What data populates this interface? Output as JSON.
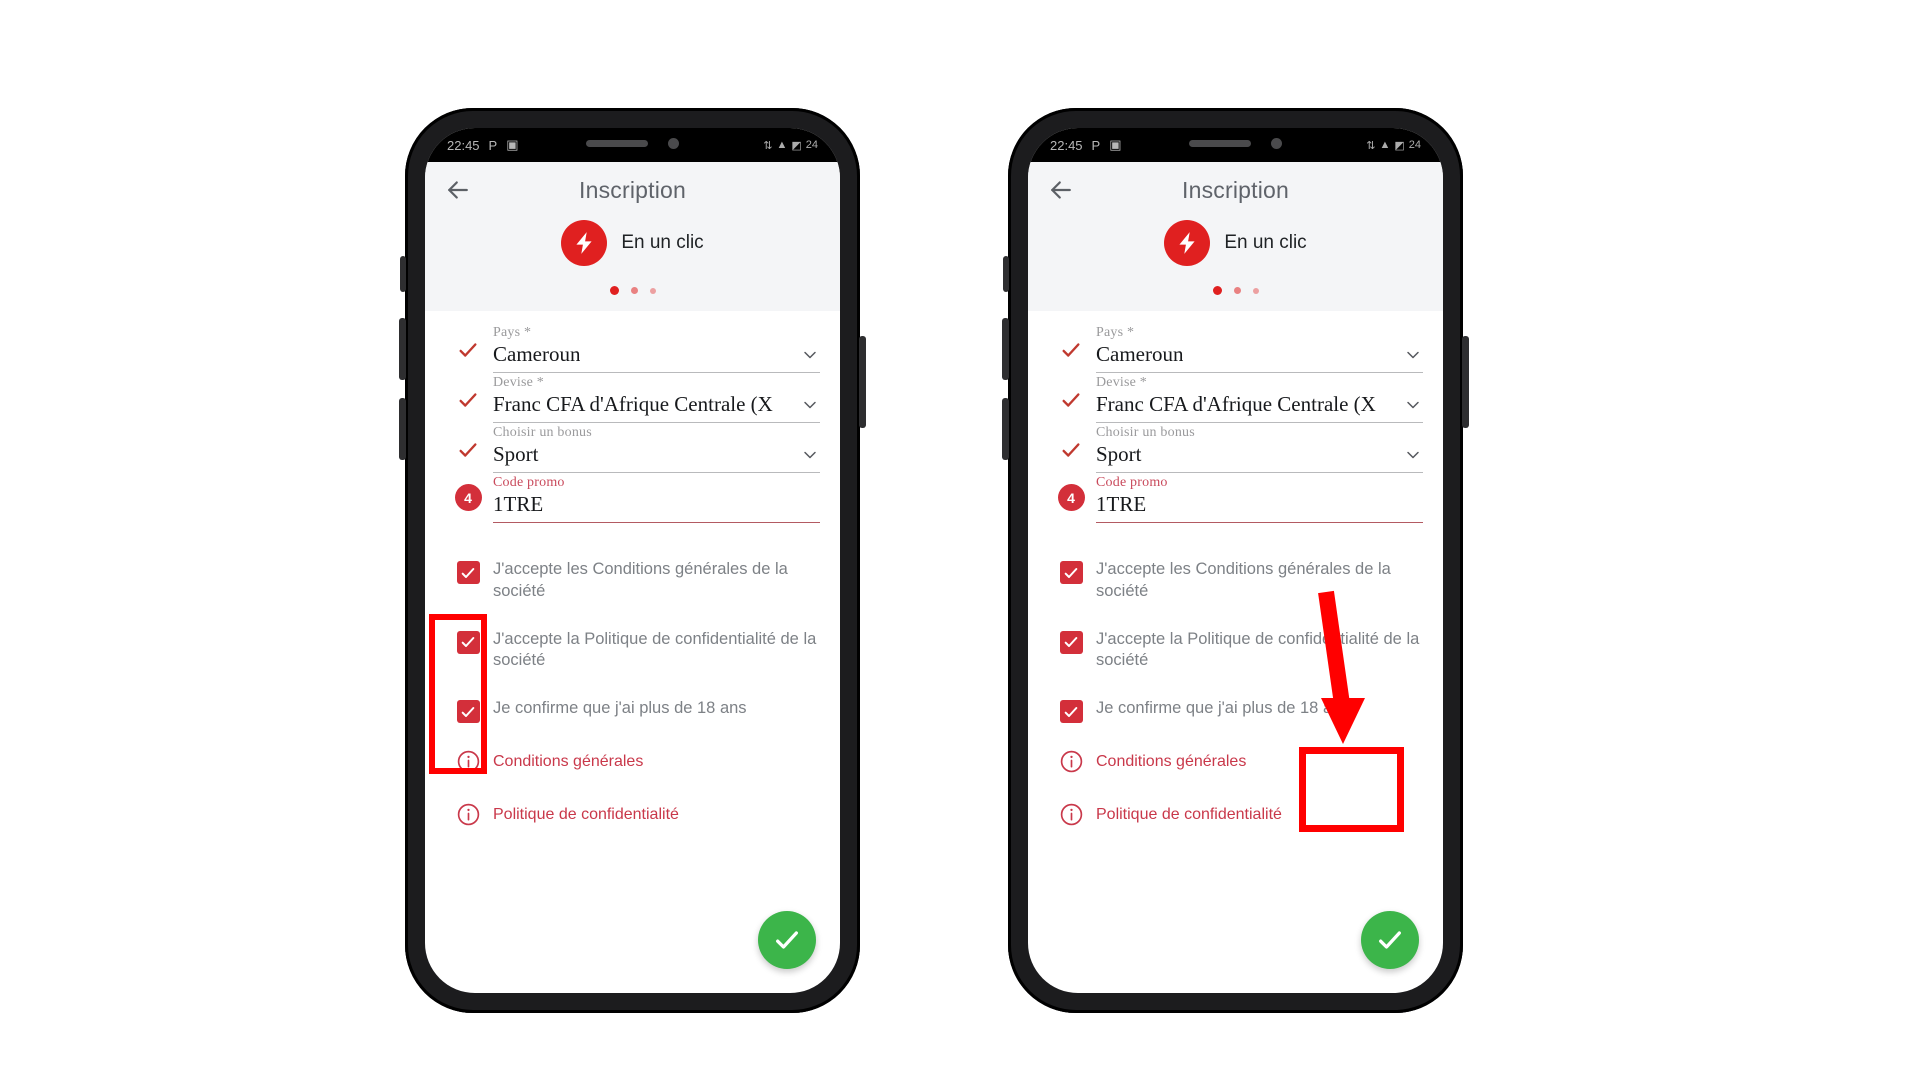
{
  "colors": {
    "brand_red": "#e02020",
    "accent_red": "#d32f3a",
    "link_red": "#c9384a",
    "promo_label": "#c94a5c",
    "check_red": "#d32f3a",
    "fab_green": "#3cb54a",
    "annotation_red": "#ff0000",
    "title_grey": "#5f636a",
    "label_grey": "#9a9a9c",
    "text_grey": "#7d8186",
    "value_dark": "#17191c",
    "screen_bg_top": "#f4f5f7"
  },
  "status_bar": {
    "time": "22:45",
    "left_icons": [
      "P",
      "message-icon"
    ],
    "right_icons": [
      "network-icon",
      "wifi-icon",
      "signal-icon"
    ],
    "battery": "24"
  },
  "header": {
    "back_icon": "arrow-left-icon",
    "title": "Inscription",
    "promo_icon": "bolt-icon",
    "promo_label": "En un clic",
    "dots": 3,
    "active_dot": 1
  },
  "form": {
    "fields": [
      {
        "label": "Pays *",
        "value": "Cameroun",
        "lead": "check",
        "control": "chevron-down-icon",
        "promo": false
      },
      {
        "label": "Devise *",
        "value": "Franc CFA d'Afrique Centrale (X",
        "lead": "check",
        "control": "chevron-down-icon",
        "promo": false
      },
      {
        "label": "Choisir un bonus",
        "value": "Sport",
        "lead": "check",
        "control": "chevron-down-icon",
        "promo": false
      },
      {
        "label": "Code promo",
        "value": "1TRE",
        "lead": "badge",
        "badge_text": "4",
        "control": "none",
        "promo": true
      }
    ]
  },
  "checkboxes": [
    {
      "checked": true,
      "label": "J'accepte les Conditions générales de la société"
    },
    {
      "checked": true,
      "label": "J'accepte la Politique de confidentialité de la société"
    },
    {
      "checked": true,
      "label": "Je confirme que j'ai plus de 18 ans"
    }
  ],
  "links": [
    {
      "icon": "info-icon",
      "label": "Conditions générales"
    },
    {
      "icon": "info-icon",
      "label": "Politique de confidentialité"
    }
  ],
  "fab": {
    "icon": "check-icon",
    "label": "Valider"
  },
  "annotations": {
    "left_phone": {
      "type": "rectangle-highlight",
      "target": "checkbox-column"
    },
    "right_phone": {
      "type": "arrow-and-rectangle",
      "target": "submit-fab"
    }
  }
}
